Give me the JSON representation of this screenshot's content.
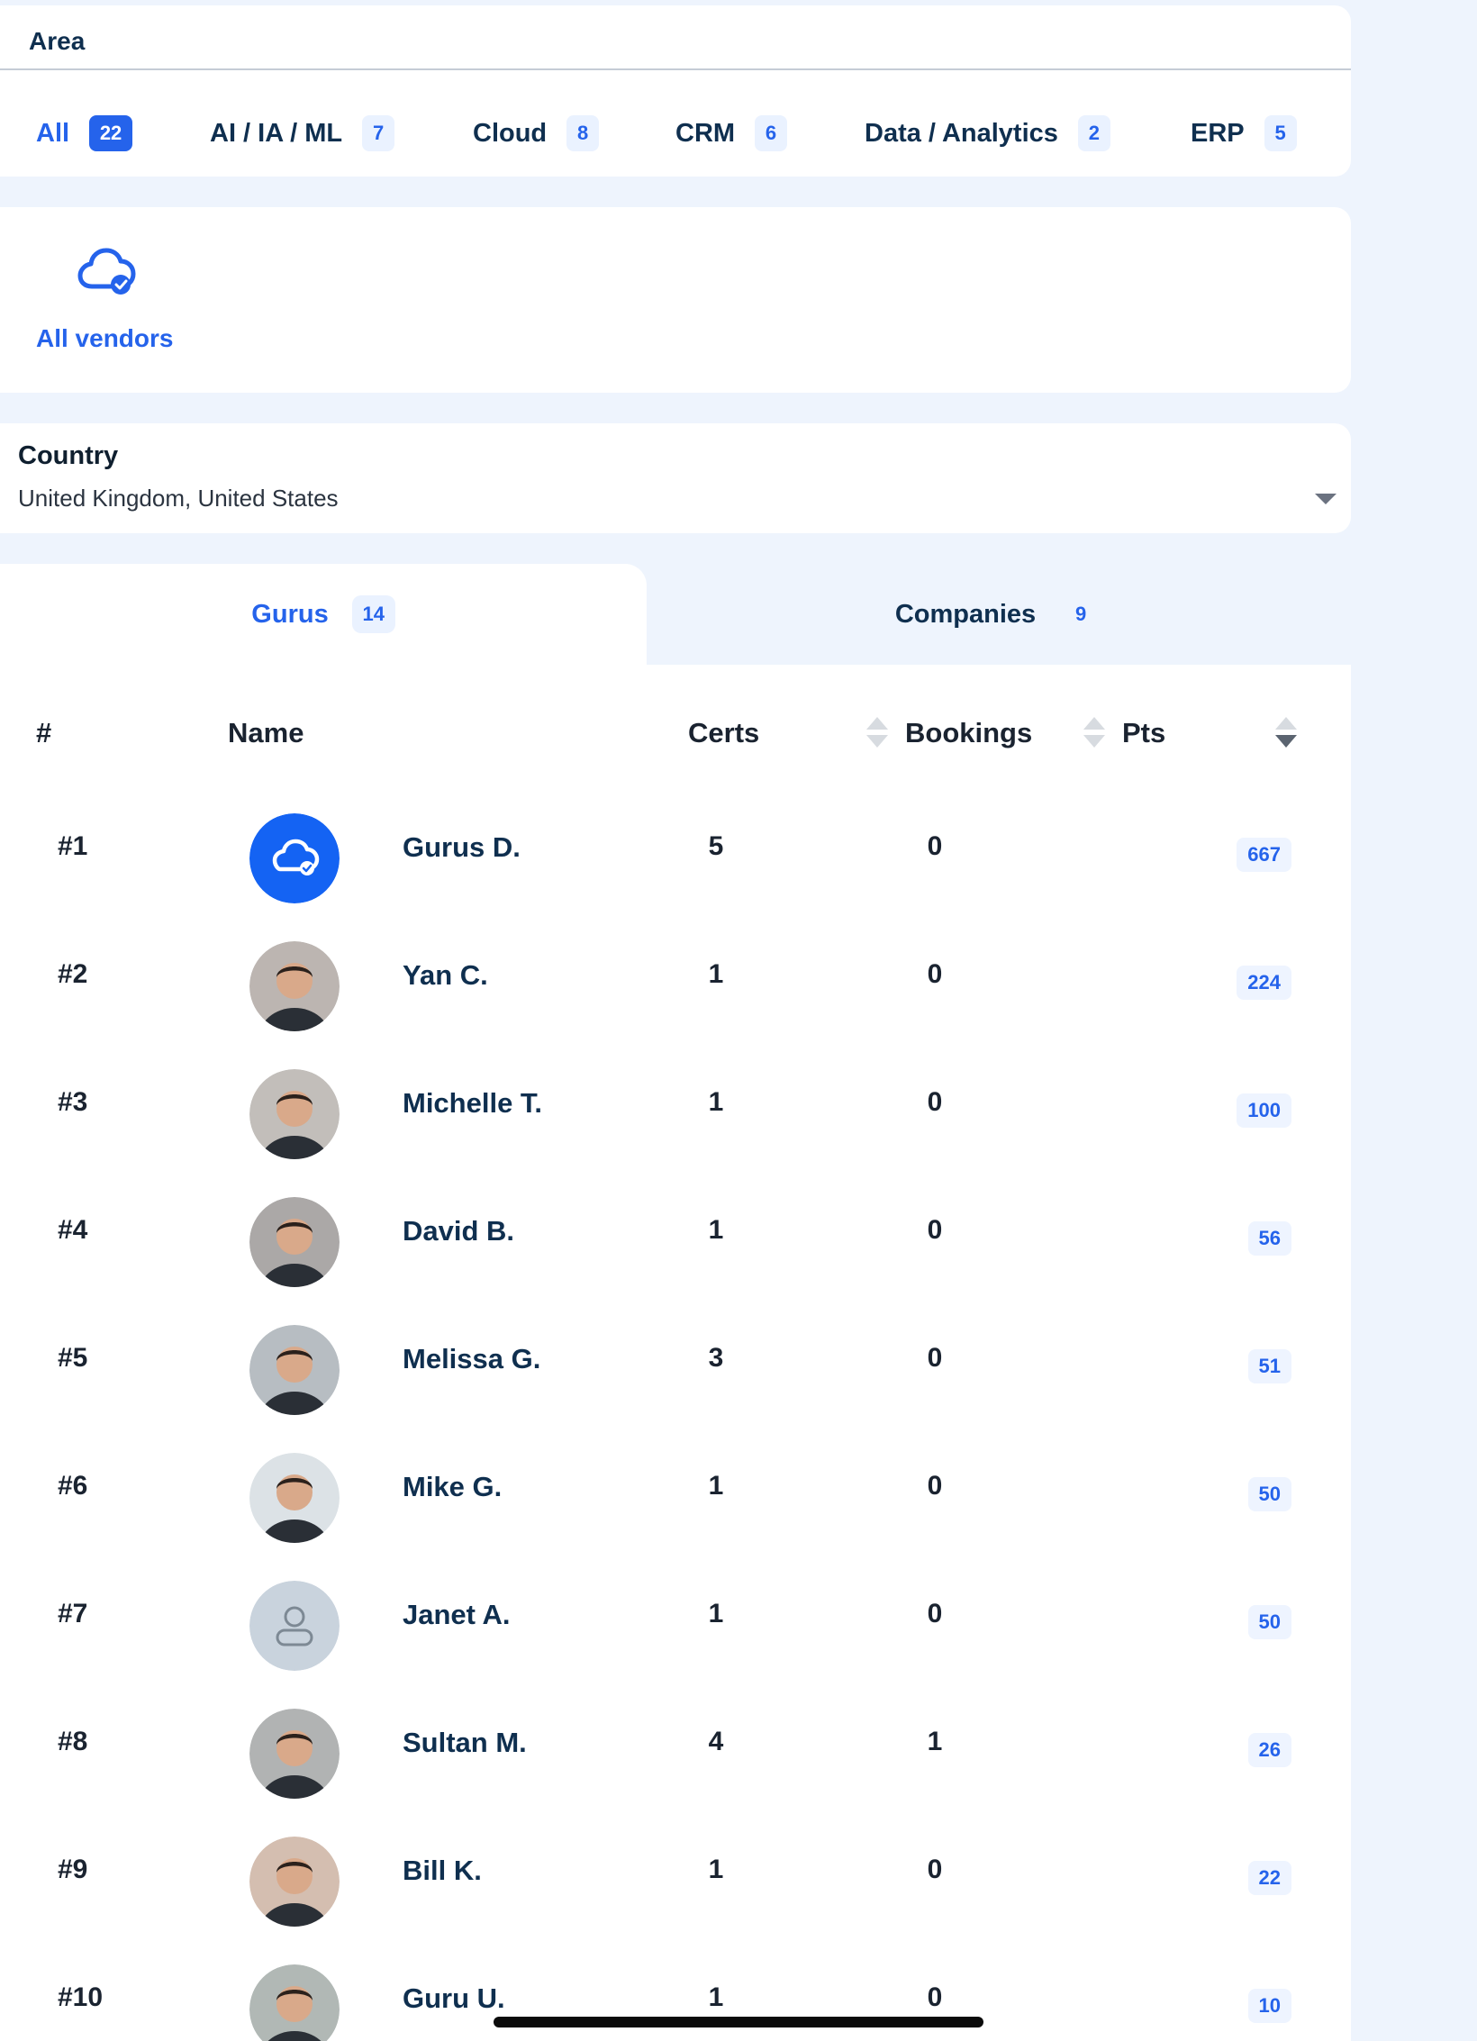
{
  "area": {
    "title": "Area",
    "tabs": [
      {
        "label": "All",
        "count": "22",
        "active": true
      },
      {
        "label": "AI / IA / ML",
        "count": "7"
      },
      {
        "label": "Cloud",
        "count": "8"
      },
      {
        "label": "CRM",
        "count": "6"
      },
      {
        "label": "Data / Analytics",
        "count": "2"
      },
      {
        "label": "ERP",
        "count": "5"
      }
    ]
  },
  "vendors": {
    "label": "All vendors",
    "icon": "cloud-check-icon"
  },
  "country": {
    "label": "Country",
    "value": "United Kingdom, United States"
  },
  "tabs": {
    "gurus": {
      "label": "Gurus",
      "count": "14"
    },
    "companies": {
      "label": "Companies",
      "count": "9"
    }
  },
  "table": {
    "headers": {
      "rank": "#",
      "name": "Name",
      "certs": "Certs",
      "bookings": "Bookings",
      "pts": "Pts"
    },
    "rows": [
      {
        "rank": "#1",
        "name": "Gurus D.",
        "certs": "5",
        "bookings": "0",
        "pts": "667",
        "avatar": "brand-cloud"
      },
      {
        "rank": "#2",
        "name": "Yan C.",
        "certs": "1",
        "bookings": "0",
        "pts": "224",
        "avatar": "photo"
      },
      {
        "rank": "#3",
        "name": "Michelle T.",
        "certs": "1",
        "bookings": "0",
        "pts": "100",
        "avatar": "photo"
      },
      {
        "rank": "#4",
        "name": "David B.",
        "certs": "1",
        "bookings": "0",
        "pts": "56",
        "avatar": "photo"
      },
      {
        "rank": "#5",
        "name": "Melissa G.",
        "certs": "3",
        "bookings": "0",
        "pts": "51",
        "avatar": "photo"
      },
      {
        "rank": "#6",
        "name": "Mike G.",
        "certs": "1",
        "bookings": "0",
        "pts": "50",
        "avatar": "photo"
      },
      {
        "rank": "#7",
        "name": "Janet A.",
        "certs": "1",
        "bookings": "0",
        "pts": "50",
        "avatar": "placeholder"
      },
      {
        "rank": "#8",
        "name": "Sultan M.",
        "certs": "4",
        "bookings": "1",
        "pts": "26",
        "avatar": "photo"
      },
      {
        "rank": "#9",
        "name": "Bill K.",
        "certs": "1",
        "bookings": "0",
        "pts": "22",
        "avatar": "photo"
      },
      {
        "rank": "#10",
        "name": "Guru U.",
        "certs": "1",
        "bookings": "0",
        "pts": "10",
        "avatar": "photo"
      }
    ]
  },
  "colors": {
    "accent": "#2563eb",
    "background": "#eef4fd",
    "text": "#0f2f4f"
  }
}
